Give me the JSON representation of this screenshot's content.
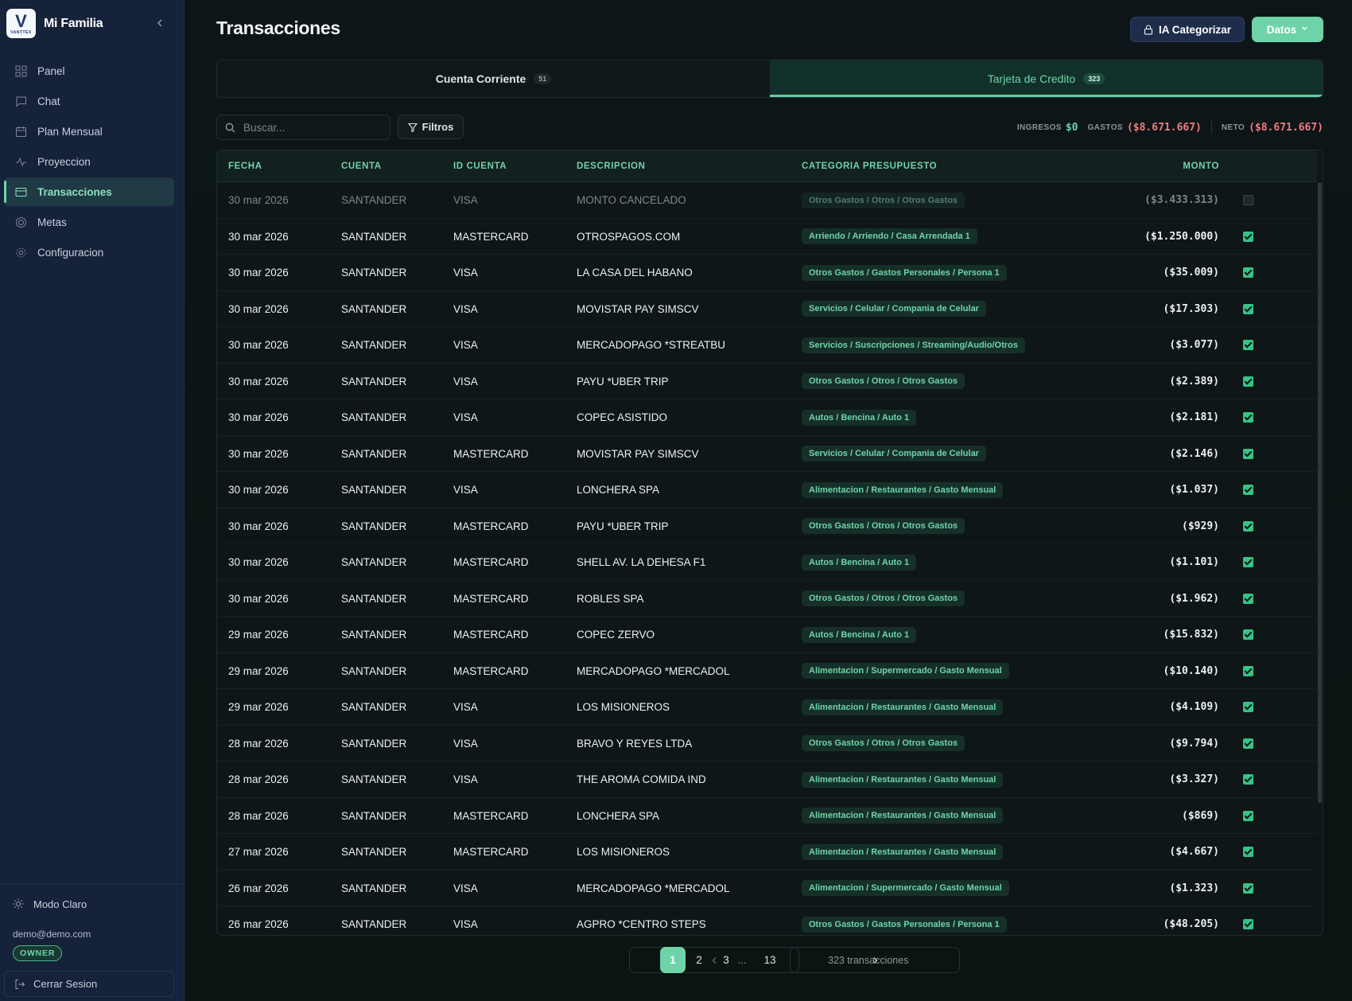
{
  "sidebar": {
    "brand": "Mi Familia",
    "logo_letter": "V",
    "logo_text": "VANTTEX",
    "nav": [
      {
        "label": "Panel",
        "icon": "grid-icon"
      },
      {
        "label": "Chat",
        "icon": "chat-icon"
      },
      {
        "label": "Plan Mensual",
        "icon": "calendar-icon"
      },
      {
        "label": "Proyeccion",
        "icon": "pulse-icon"
      },
      {
        "label": "Transacciones",
        "icon": "card-icon",
        "active": true
      },
      {
        "label": "Metas",
        "icon": "target-icon"
      },
      {
        "label": "Configuracion",
        "icon": "gear-icon"
      }
    ],
    "mode_label": "Modo Claro",
    "email": "demo@demo.com",
    "role": "OWNER",
    "logout_label": "Cerrar Sesion"
  },
  "header": {
    "title": "Transacciones",
    "ai_button": "IA Categorizar",
    "data_button": "Datos"
  },
  "tabs": [
    {
      "label": "Cuenta Corriente",
      "count": "51"
    },
    {
      "label": "Tarjeta de Credito",
      "count": "323",
      "active": true
    }
  ],
  "search": {
    "placeholder": "Buscar..."
  },
  "filters_label": "Filtros",
  "totals": {
    "ingresos_label": "INGRESOS",
    "ingresos_value": "$0",
    "gastos_label": "GASTOS",
    "gastos_value": "($8.671.667)",
    "neto_label": "NETO",
    "neto_value": "($8.671.667)"
  },
  "table": {
    "columns": [
      "FECHA",
      "CUENTA",
      "ID CUENTA",
      "DESCRIPCION",
      "CATEGORIA PRESUPUESTO",
      "MONTO"
    ],
    "rows": [
      {
        "fecha": "30 mar 2026",
        "cuenta": "SANTANDER",
        "id": "VISA",
        "desc": "MONTO CANCELADO",
        "cat": "Otros Gastos / Otros / Otros Gastos",
        "monto": "($3.433.313)",
        "checked": false
      },
      {
        "fecha": "30 mar 2026",
        "cuenta": "SANTANDER",
        "id": "MASTERCARD",
        "desc": "OTROSPAGOS.COM",
        "cat": "Arriendo / Arriendo / Casa Arrendada 1",
        "monto": "($1.250.000)",
        "checked": true
      },
      {
        "fecha": "30 mar 2026",
        "cuenta": "SANTANDER",
        "id": "VISA",
        "desc": "LA CASA DEL HABANO",
        "cat": "Otros Gastos / Gastos Personales / Persona 1",
        "monto": "($35.009)",
        "checked": true
      },
      {
        "fecha": "30 mar 2026",
        "cuenta": "SANTANDER",
        "id": "VISA",
        "desc": "MOVISTAR PAY SIMSCV",
        "cat": "Servicios / Celular / Compania de Celular",
        "monto": "($17.303)",
        "checked": true
      },
      {
        "fecha": "30 mar 2026",
        "cuenta": "SANTANDER",
        "id": "VISA",
        "desc": "MERCADOPAGO *STREATBU",
        "cat": "Servicios / Suscripciones / Streaming/Audio/Otros",
        "monto": "($3.077)",
        "checked": true
      },
      {
        "fecha": "30 mar 2026",
        "cuenta": "SANTANDER",
        "id": "VISA",
        "desc": "PAYU *UBER TRIP",
        "cat": "Otros Gastos / Otros / Otros Gastos",
        "monto": "($2.389)",
        "checked": true
      },
      {
        "fecha": "30 mar 2026",
        "cuenta": "SANTANDER",
        "id": "VISA",
        "desc": "COPEC ASISTIDO",
        "cat": "Autos / Bencina / Auto 1",
        "monto": "($2.181)",
        "checked": true
      },
      {
        "fecha": "30 mar 2026",
        "cuenta": "SANTANDER",
        "id": "MASTERCARD",
        "desc": "MOVISTAR PAY SIMSCV",
        "cat": "Servicios / Celular / Compania de Celular",
        "monto": "($2.146)",
        "checked": true
      },
      {
        "fecha": "30 mar 2026",
        "cuenta": "SANTANDER",
        "id": "VISA",
        "desc": "LONCHERA SPA",
        "cat": "Alimentacion / Restaurantes / Gasto Mensual",
        "monto": "($1.037)",
        "checked": true
      },
      {
        "fecha": "30 mar 2026",
        "cuenta": "SANTANDER",
        "id": "MASTERCARD",
        "desc": "PAYU *UBER TRIP",
        "cat": "Otros Gastos / Otros / Otros Gastos",
        "monto": "($929)",
        "checked": true
      },
      {
        "fecha": "30 mar 2026",
        "cuenta": "SANTANDER",
        "id": "MASTERCARD",
        "desc": "SHELL AV. LA DEHESA F1",
        "cat": "Autos / Bencina / Auto 1",
        "monto": "($1.101)",
        "checked": true
      },
      {
        "fecha": "30 mar 2026",
        "cuenta": "SANTANDER",
        "id": "MASTERCARD",
        "desc": "ROBLES SPA",
        "cat": "Otros Gastos / Otros / Otros Gastos",
        "monto": "($1.962)",
        "checked": true
      },
      {
        "fecha": "29 mar 2026",
        "cuenta": "SANTANDER",
        "id": "MASTERCARD",
        "desc": "COPEC ZERVO",
        "cat": "Autos / Bencina / Auto 1",
        "monto": "($15.832)",
        "checked": true
      },
      {
        "fecha": "29 mar 2026",
        "cuenta": "SANTANDER",
        "id": "MASTERCARD",
        "desc": "MERCADOPAGO *MERCADOL",
        "cat": "Alimentacion / Supermercado / Gasto Mensual",
        "monto": "($10.140)",
        "checked": true
      },
      {
        "fecha": "29 mar 2026",
        "cuenta": "SANTANDER",
        "id": "VISA",
        "desc": "LOS MISIONEROS",
        "cat": "Alimentacion / Restaurantes / Gasto Mensual",
        "monto": "($4.109)",
        "checked": true
      },
      {
        "fecha": "28 mar 2026",
        "cuenta": "SANTANDER",
        "id": "VISA",
        "desc": "BRAVO Y REYES LTDA",
        "cat": "Otros Gastos / Otros / Otros Gastos",
        "monto": "($9.794)",
        "checked": true
      },
      {
        "fecha": "28 mar 2026",
        "cuenta": "SANTANDER",
        "id": "VISA",
        "desc": "THE AROMA COMIDA IND",
        "cat": "Alimentacion / Restaurantes / Gasto Mensual",
        "monto": "($3.327)",
        "checked": true
      },
      {
        "fecha": "28 mar 2026",
        "cuenta": "SANTANDER",
        "id": "MASTERCARD",
        "desc": "LONCHERA SPA",
        "cat": "Alimentacion / Restaurantes / Gasto Mensual",
        "monto": "($869)",
        "checked": true
      },
      {
        "fecha": "27 mar 2026",
        "cuenta": "SANTANDER",
        "id": "MASTERCARD",
        "desc": "LOS MISIONEROS",
        "cat": "Alimentacion / Restaurantes / Gasto Mensual",
        "monto": "($4.667)",
        "checked": true
      },
      {
        "fecha": "26 mar 2026",
        "cuenta": "SANTANDER",
        "id": "VISA",
        "desc": "MERCADOPAGO *MERCADOL",
        "cat": "Alimentacion / Supermercado / Gasto Mensual",
        "monto": "($1.323)",
        "checked": true
      },
      {
        "fecha": "26 mar 2026",
        "cuenta": "SANTANDER",
        "id": "VISA",
        "desc": "AGPRO *CENTRO STEPS",
        "cat": "Otros Gastos / Gastos Personales / Persona 1",
        "monto": "($48.205)",
        "checked": true
      }
    ]
  },
  "pagination": {
    "pages": [
      "1",
      "2",
      "3"
    ],
    "ellipsis": "...",
    "last": "13",
    "current": "1",
    "info": "323 transacciones"
  },
  "colors": {
    "accent": "#6fd3a9",
    "negative": "#f07d7d",
    "sidebar": "#16213a",
    "background": "#0b1411"
  }
}
